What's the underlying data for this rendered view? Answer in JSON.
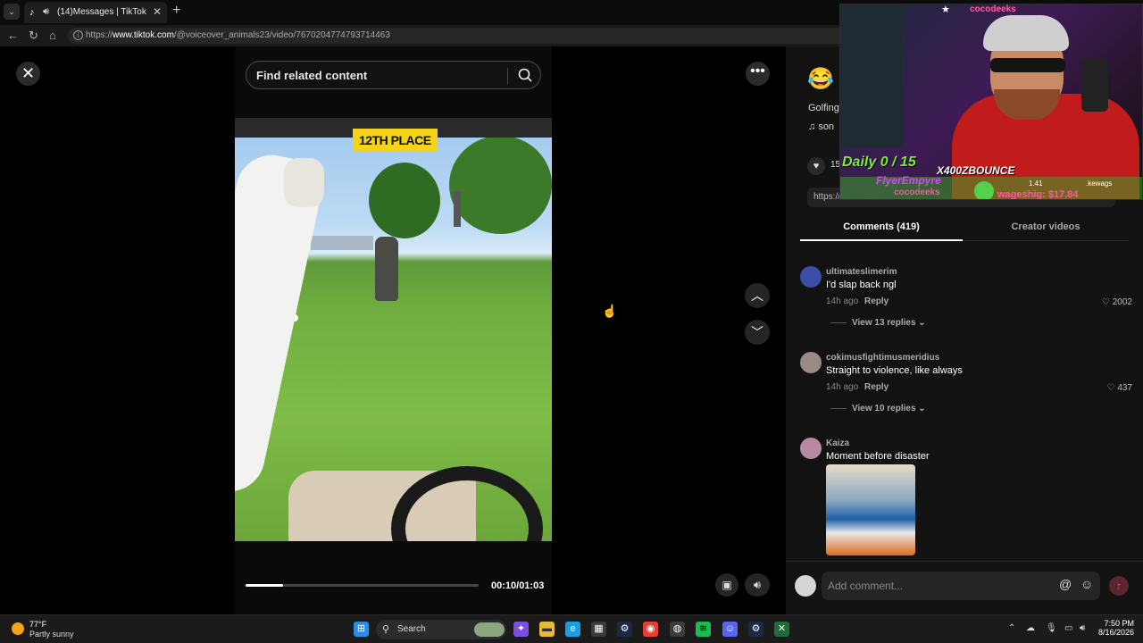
{
  "browser": {
    "tab_title": "(14)Messages | TikTok",
    "tab_favicon": "♪",
    "url_prefix": "https://",
    "url_domain": "www.tiktok.com",
    "url_path": "/@voiceover_animals23/video/7670204774793714463"
  },
  "video": {
    "search_placeholder": "Find related content",
    "overlay_badge": "12TH PLACE",
    "time_display": "00:10/01:03",
    "progress_fraction": 0.16
  },
  "panel": {
    "emoji": "😂",
    "description": "Golfing",
    "music_prefix": "♫",
    "music_text": "son",
    "like_count": "15",
    "link_text": "https://w",
    "tabs": {
      "comments": "Comments (419)",
      "creator": "Creator videos"
    },
    "comments": [
      {
        "user": "ultimateslimerim",
        "text": "I'd slap back ngl",
        "time": "14h ago",
        "reply": "Reply",
        "likes": "2002",
        "view_replies": "View 13 replies",
        "avatar_color": "#3a4fa8"
      },
      {
        "user": "cokimusfightimusmeridius",
        "text": "Straight to violence, like always",
        "time": "14h ago",
        "reply": "Reply",
        "likes": "437",
        "view_replies": "View 10 replies",
        "avatar_color": "#9a8a86"
      },
      {
        "user": "Kaiza",
        "text": "Moment before disaster",
        "avatar_color": "#b58aa0"
      }
    ],
    "composer_placeholder": "Add comment..."
  },
  "stream_overlay": {
    "top_name": "cocodeeks",
    "daily": "Daily 0 / 15",
    "bottom_title": "X400ZBOUNCE",
    "flyer": "FlyerEmpyre",
    "coco": "cocodeeks",
    "wager": "wageshig: $17.84",
    "num": "1.41",
    "kew": ".kewags"
  },
  "taskbar": {
    "temp": "77°F",
    "weather": "Partly sunny",
    "search_label": "Search",
    "time": "7:50 PM",
    "date": "8/16/2026"
  },
  "colors": {
    "badge": "#f5d21b",
    "send_button": "#5a2430",
    "accent_green": "#7eea3a"
  }
}
